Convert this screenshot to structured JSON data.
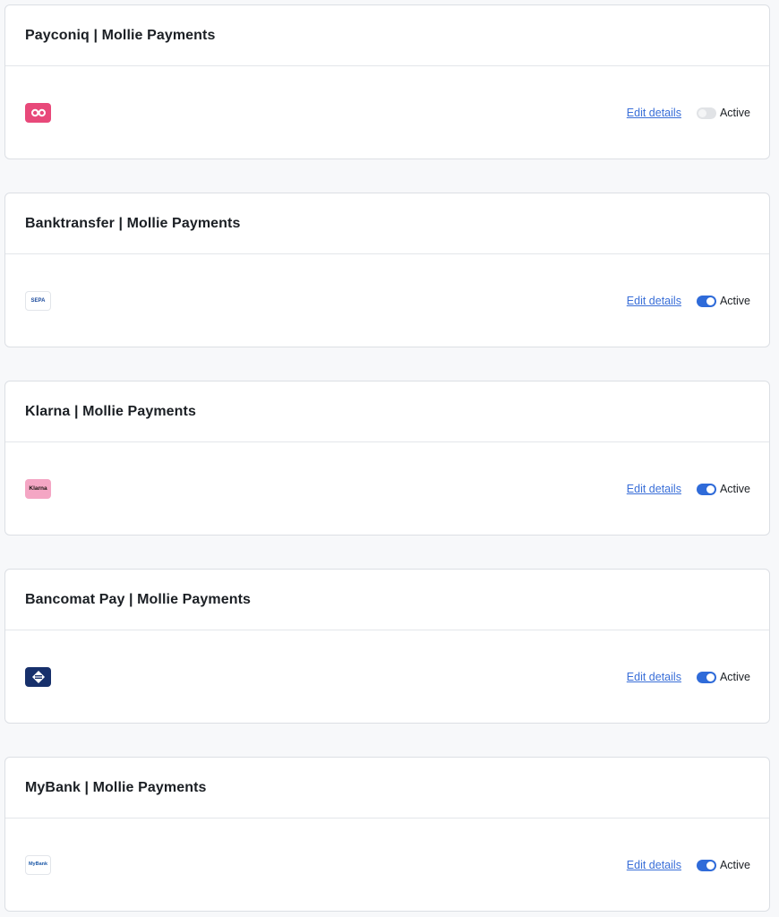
{
  "payment_methods": [
    {
      "title": "Payconiq | Mollie Payments",
      "logo_icon": "payconiq-logo-icon",
      "logo_text": "",
      "edit_label": "Edit details",
      "status_label": "Active",
      "active": false
    },
    {
      "title": "Banktransfer | Mollie Payments",
      "logo_icon": "sepa-logo-icon",
      "logo_text": "SEPA",
      "edit_label": "Edit details",
      "status_label": "Active",
      "active": true
    },
    {
      "title": "Klarna | Mollie Payments",
      "logo_icon": "klarna-logo-icon",
      "logo_text": "Klarna",
      "edit_label": "Edit details",
      "status_label": "Active",
      "active": true
    },
    {
      "title": "Bancomat Pay | Mollie Payments",
      "logo_icon": "bancomat-pay-logo-icon",
      "logo_text": "",
      "edit_label": "Edit details",
      "status_label": "Active",
      "active": true
    },
    {
      "title": "MyBank | Mollie Payments",
      "logo_icon": "mybank-logo-icon",
      "logo_text": "MyBank",
      "edit_label": "Edit details",
      "status_label": "Active",
      "active": true
    }
  ],
  "colors": {
    "link": "#3a6fd8",
    "toggle_on": "#2f6bd9",
    "toggle_off": "#e1e3e6",
    "payconiq": "#e8497a",
    "klarna": "#f4a6c4",
    "bancomat": "#17306b"
  }
}
